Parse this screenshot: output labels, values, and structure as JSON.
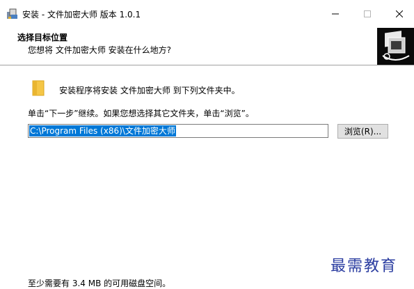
{
  "window": {
    "title": "安装 - 文件加密大师 版本 1.0.1",
    "minimize_glyph": "–",
    "maximize_glyph": "☐",
    "close_glyph": "✕"
  },
  "header": {
    "title": "选择目标位置",
    "subtitle": "您想将 文件加密大师 安装在什么地方?"
  },
  "body": {
    "info": "安装程序将安装 文件加密大师 到下列文件夹中。",
    "hint": "单击“下一步”继续。如果您想选择其它文件夹，单击“浏览”。",
    "path_value": "C:\\Program Files (x86)\\文件加密大师",
    "browse_label": "浏览(R)...",
    "space_required": "至少需要有 3.4 MB 的可用磁盘空间。"
  },
  "watermark": "最需教育",
  "icons": {
    "app": "installer-icon",
    "logo": "installer-wizard-logo",
    "folder": "folder-icon"
  },
  "colors": {
    "selection": "#0078d7",
    "watermark": "#2a3ca0",
    "logo_bg": "#0a0a0a"
  }
}
